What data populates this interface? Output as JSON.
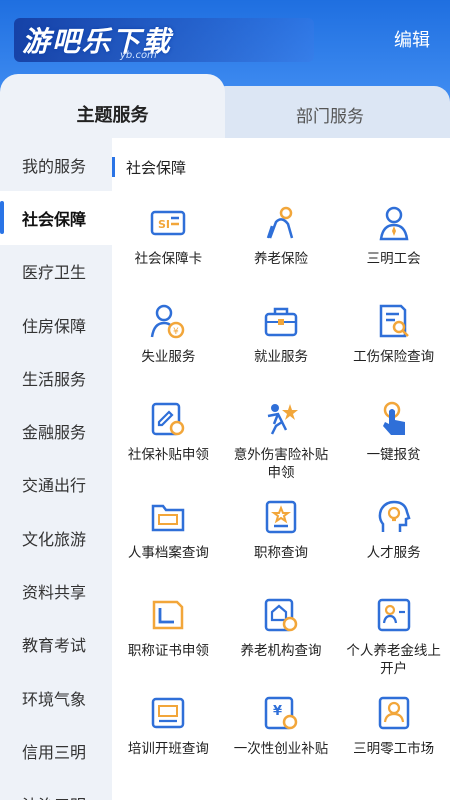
{
  "header": {
    "watermark_text": "游吧乐下载",
    "watermark_sub": "yb.com",
    "edit_label": "编辑"
  },
  "tabs": [
    {
      "label": "主题服务",
      "active": true
    },
    {
      "label": "部门服务",
      "active": false
    }
  ],
  "sidebar": {
    "items": [
      {
        "label": "我的服务"
      },
      {
        "label": "社会保障",
        "active": true
      },
      {
        "label": "医疗卫生"
      },
      {
        "label": "住房保障"
      },
      {
        "label": "生活服务"
      },
      {
        "label": "金融服务"
      },
      {
        "label": "交通出行"
      },
      {
        "label": "文化旅游"
      },
      {
        "label": "资料共享"
      },
      {
        "label": "教育考试"
      },
      {
        "label": "环境气象"
      },
      {
        "label": "信用三明"
      },
      {
        "label": "法治三明"
      }
    ]
  },
  "section": {
    "title": "社会保障"
  },
  "services": [
    {
      "label": "社会保障卡",
      "icon": "social-security-card-icon"
    },
    {
      "label": "养老保险",
      "icon": "pension-insurance-icon"
    },
    {
      "label": "三明工会",
      "icon": "trade-union-icon"
    },
    {
      "label": "失业服务",
      "icon": "unemployment-icon"
    },
    {
      "label": "就业服务",
      "icon": "briefcase-icon"
    },
    {
      "label": "工伤保险查询",
      "icon": "injury-insurance-query-icon"
    },
    {
      "label": "社保补贴申领",
      "icon": "subsidy-apply-icon"
    },
    {
      "label": "意外伤害险补贴申领",
      "icon": "accident-insurance-icon"
    },
    {
      "label": "一键报贫",
      "icon": "tap-hand-icon"
    },
    {
      "label": "人事档案查询",
      "icon": "archive-folder-icon"
    },
    {
      "label": "职称查询",
      "icon": "title-certificate-icon"
    },
    {
      "label": "人才服务",
      "icon": "talent-bulb-icon"
    },
    {
      "label": "职称证书申领",
      "icon": "certificate-book-icon"
    },
    {
      "label": "养老机构查询",
      "icon": "nursing-home-icon"
    },
    {
      "label": "个人养老金线上开户",
      "icon": "pension-account-icon"
    },
    {
      "label": "培训开班查询",
      "icon": "training-icon"
    },
    {
      "label": "一次性创业补贴",
      "icon": "startup-subsidy-icon"
    },
    {
      "label": "三明零工市场",
      "icon": "gig-market-icon"
    }
  ],
  "colors": {
    "accent": "#2a74e6",
    "icon_blue": "#2f6fd8",
    "icon_orange": "#f2a63a",
    "header": "#1f6fe0"
  }
}
